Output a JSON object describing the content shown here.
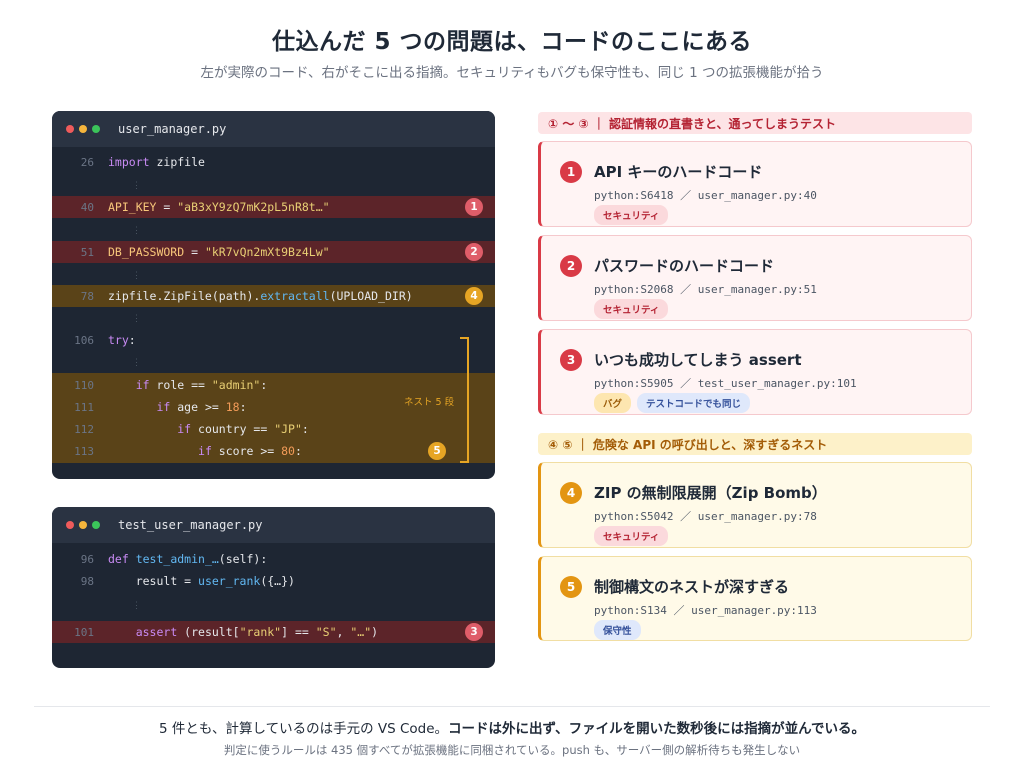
{
  "title": "仕込んだ 5 つの問題は、コードのここにある",
  "subtitle": "左が実際のコード、右がそこに出る指摘。セキュリティもバグも保守性も、同じ 1 つの拡張機能が拾う",
  "editor1": {
    "filename": "user_manager.py",
    "lines": [
      {
        "no": "26",
        "kw": "import",
        "rest": " zipfile"
      },
      {
        "no": "40",
        "var": "API_KEY",
        "op": " = ",
        "str": "\"aB3xY9zQ7mK2pL5nR8t…\"",
        "badge": "1"
      },
      {
        "no": "51",
        "var": "DB_PASSWORD",
        "op": " = ",
        "str": "\"kR7vQn2mXt9Bz4Lw\"",
        "badge": "2"
      },
      {
        "no": "78",
        "pre": "zipfile.ZipFile(path).",
        "fn": "extractall",
        "post": "(UPLOAD_DIR)",
        "badge": "4"
      },
      {
        "no": "106",
        "kw": "try",
        "rest": ":"
      },
      {
        "no": "110",
        "indent": "    ",
        "kw": "if",
        "mid": " role == ",
        "str": "\"admin\"",
        "post": ":"
      },
      {
        "no": "111",
        "indent": "       ",
        "kw": "if",
        "mid": " age >= ",
        "num": "18",
        "post": ":"
      },
      {
        "no": "112",
        "indent": "          ",
        "kw": "if",
        "mid": " country == ",
        "str": "\"JP\"",
        "post": ":"
      },
      {
        "no": "113",
        "indent": "             ",
        "kw": "if",
        "mid": " score >= ",
        "num": "80",
        "post": ":",
        "badge": "5"
      }
    ],
    "nest_label": "ネスト 5 段"
  },
  "editor2": {
    "filename": "test_user_manager.py",
    "lines": [
      {
        "no": "96",
        "kw": "def",
        "fn": " test_admin_…",
        "post": "(self):"
      },
      {
        "no": "98",
        "indent": "    ",
        "pre": "result = ",
        "fn": "user_rank",
        "post": "({…})"
      },
      {
        "no": "101",
        "indent": "    ",
        "kw": "assert",
        "mid": " (result[",
        "str": "\"rank\"",
        "mid2": "] == ",
        "str2": "\"S\"",
        "mid3": ", ",
        "str3": "\"…\"",
        "post": ")",
        "badge": "3"
      }
    ]
  },
  "groups": [
    {
      "label": "① 〜 ③ ｜ 認証情報の直書きと、通ってしまうテスト",
      "tone": "red"
    },
    {
      "label": "④ ⑤ ｜ 危険な API の呼び出しと、深すぎるネスト",
      "tone": "amber"
    }
  ],
  "issues": [
    {
      "num": "1",
      "title": "API キーのハードコード",
      "meta": "python:S6418 ／ user_manager.py:40",
      "tags": [
        "セキュリティ"
      ],
      "tone": "red"
    },
    {
      "num": "2",
      "title": "パスワードのハードコード",
      "meta": "python:S2068 ／ user_manager.py:51",
      "tags": [
        "セキュリティ"
      ],
      "tone": "red"
    },
    {
      "num": "3",
      "title": "いつも成功してしまう assert",
      "meta": "python:S5905 ／ test_user_manager.py:101",
      "tags": [
        "バグ",
        "テストコードでも同じ"
      ],
      "tone": "red"
    },
    {
      "num": "4",
      "title": "ZIP の無制限展開（Zip Bomb）",
      "meta": "python:S5042 ／ user_manager.py:78",
      "tags": [
        "セキュリティ"
      ],
      "tone": "amber"
    },
    {
      "num": "5",
      "title": "制御構文のネストが深すぎる",
      "meta": "python:S134 ／ user_manager.py:113",
      "tags": [
        "保守性"
      ],
      "tone": "amber"
    }
  ],
  "footer": {
    "line1_plain": "5 件とも、計算しているのは手元の VS Code。",
    "line1_bold": "コードは外に出ず、ファイルを開いた数秒後には指摘が並んでいる。",
    "line2": "判定に使うルールは 435 個すべてが拡張機能に同梱されている。push も、サーバー側の解析待ちも発生しない"
  }
}
